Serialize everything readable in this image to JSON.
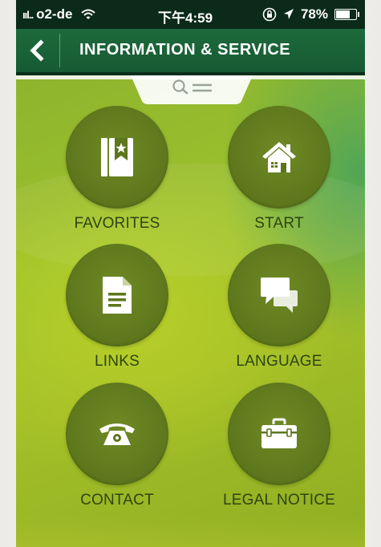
{
  "status_bar": {
    "signal": "ııl..",
    "carrier": "o2-de",
    "wifi_icon": "wifi-icon",
    "time": "下午4:59",
    "lock_icon": "orientation-lock-icon",
    "location_icon": "location-arrow-icon",
    "battery_percent": "78%",
    "battery_level": 0.78
  },
  "nav": {
    "title": "INFORMATION & SERVICE",
    "back_icon": "chevron-left-icon"
  },
  "search_tab": {
    "icons": [
      "search-icon",
      "menu-lines-icon"
    ]
  },
  "menu": [
    {
      "label": "FAVORITES",
      "icon": "bookmark-book-icon"
    },
    {
      "label": "START",
      "icon": "home-icon"
    },
    {
      "label": "LINKS",
      "icon": "document-icon"
    },
    {
      "label": "LANGUAGE",
      "icon": "speech-bubbles-icon"
    },
    {
      "label": "CONTACT",
      "icon": "telephone-icon"
    },
    {
      "label": "LEGAL NOTICE",
      "icon": "toolbox-icon"
    }
  ],
  "colors": {
    "nav_bar": "#1d6a3c",
    "status_bar": "#0b2a1a",
    "circle": "#5d761c",
    "label": "#2f4410"
  }
}
